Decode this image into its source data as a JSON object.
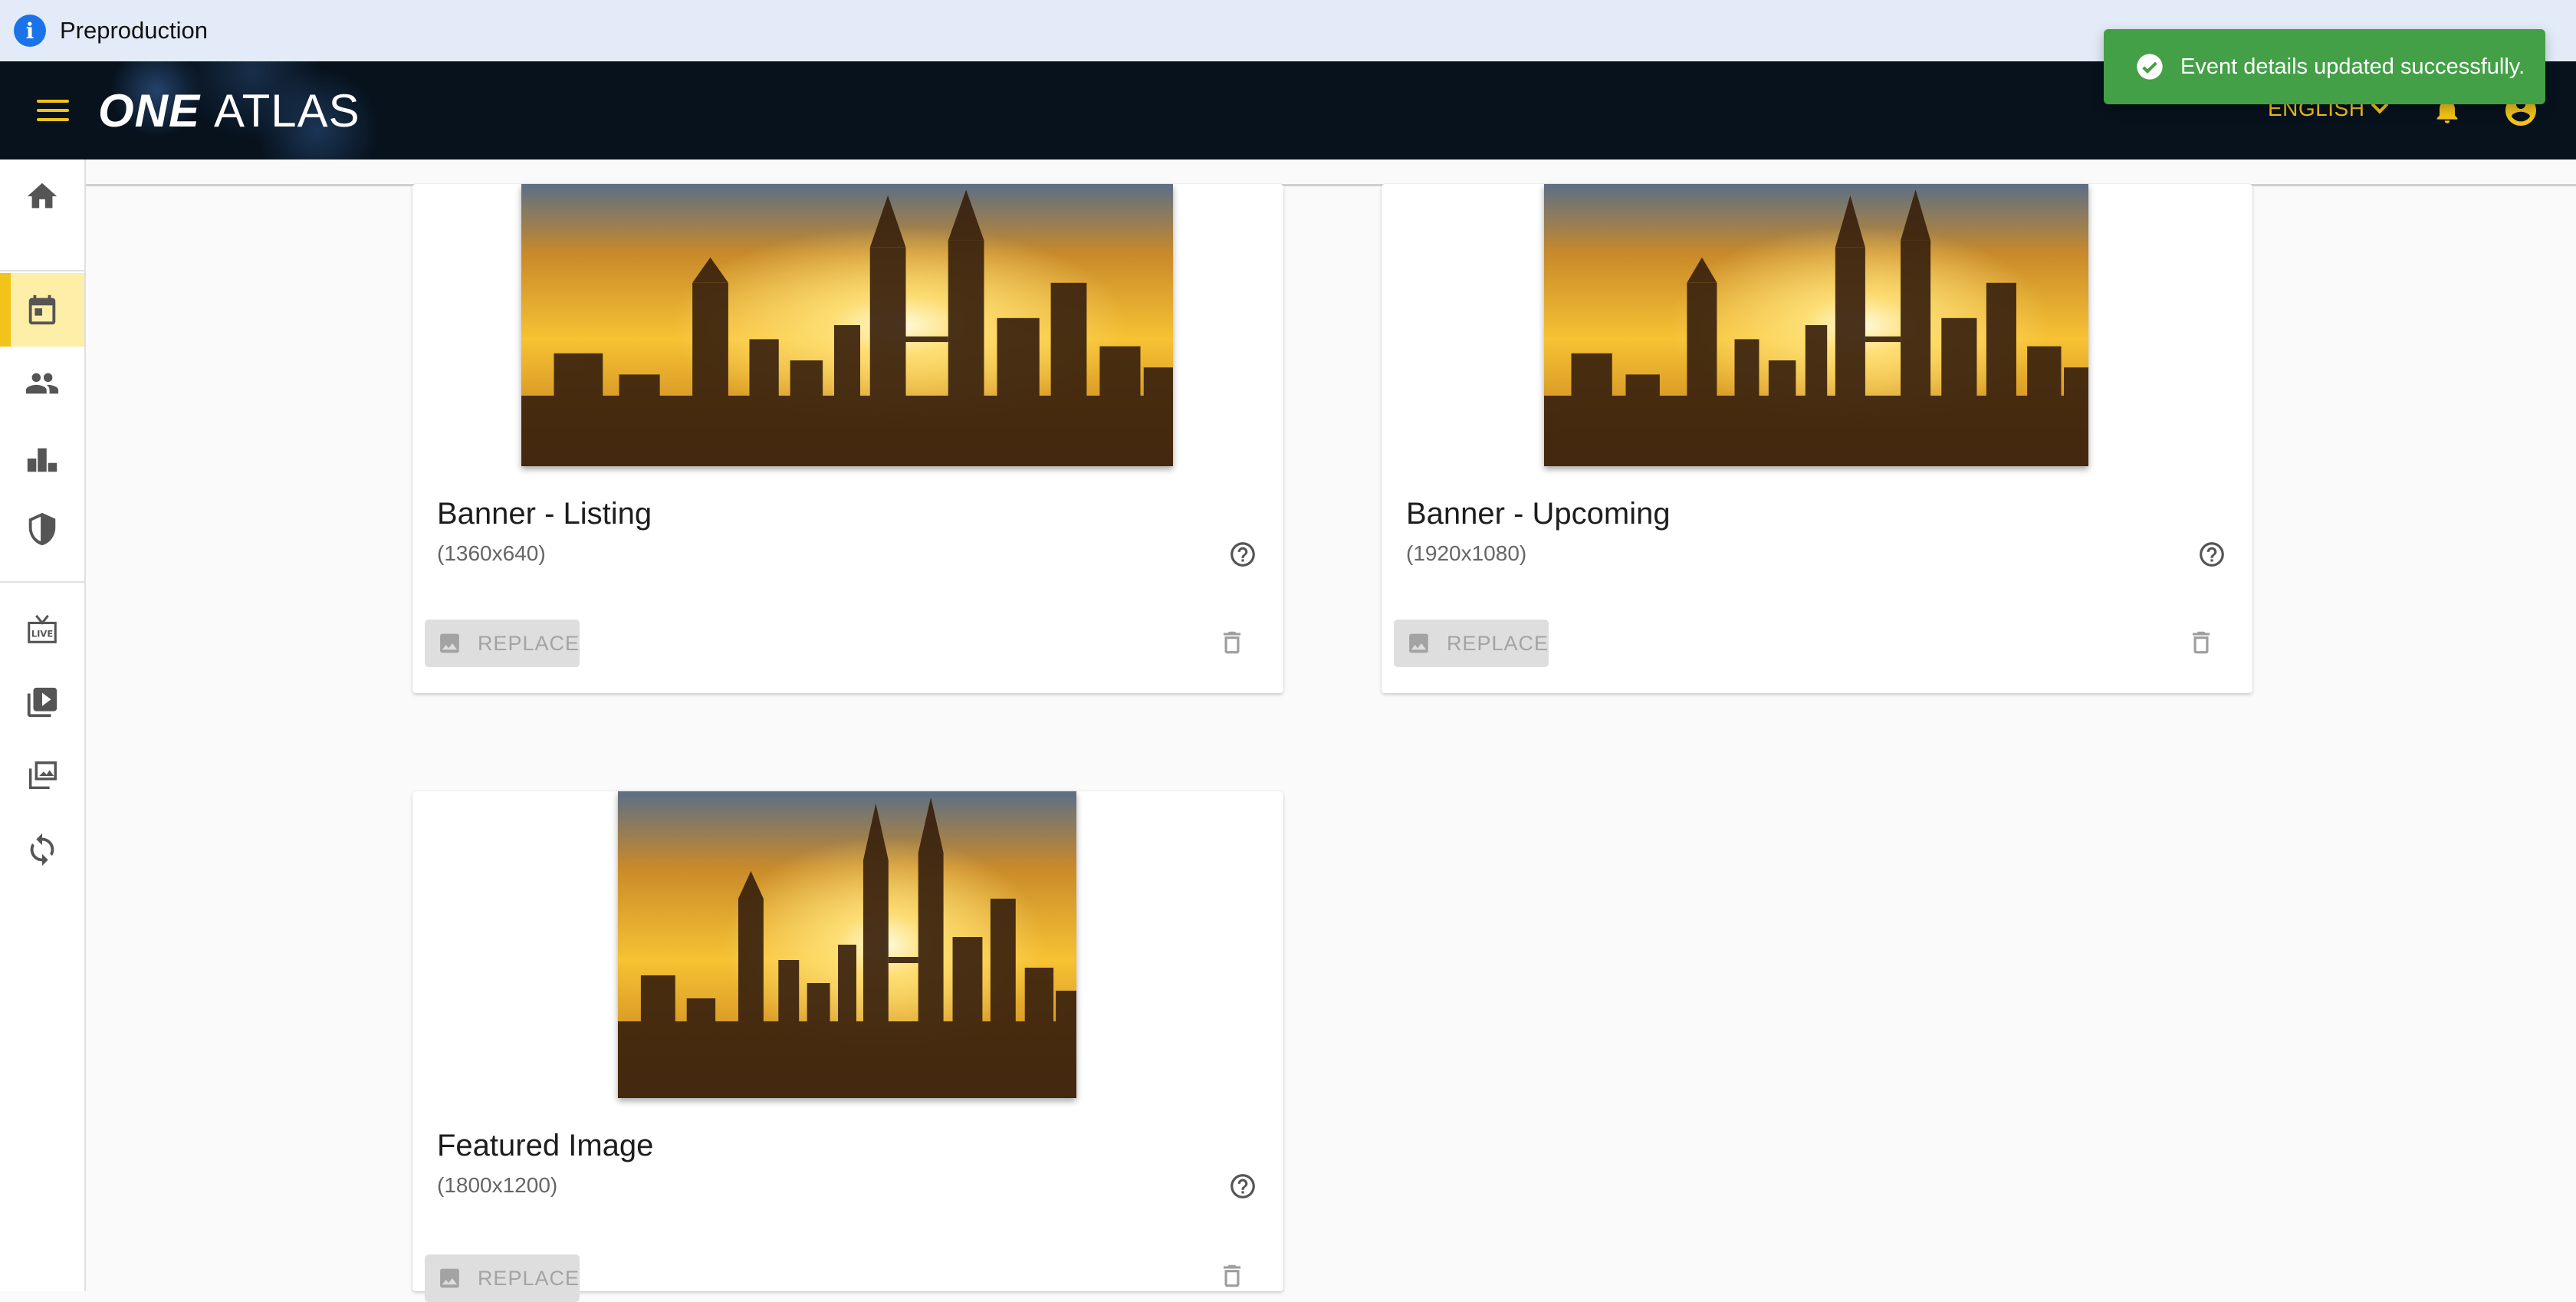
{
  "env_banner": {
    "text": "Preproduction",
    "icon": "info-icon"
  },
  "toast": {
    "message": "Event details updated successfully.",
    "icon": "check-circle-icon",
    "color": "#43a047"
  },
  "appbar": {
    "logo_one": "ONE",
    "logo_atlas": "ATLAS",
    "language": "ENGLISH",
    "accent_color": "#f2c318",
    "background_color": "#07121d"
  },
  "sidebar": {
    "items": [
      {
        "name": "home",
        "icon": "home-icon",
        "active": false
      },
      {
        "name": "events",
        "icon": "calendar-icon",
        "active": true
      },
      {
        "name": "people",
        "icon": "people-icon",
        "active": false
      },
      {
        "name": "rankings",
        "icon": "podium-icon",
        "active": false
      },
      {
        "name": "teams",
        "icon": "shield-icon",
        "active": false
      },
      {
        "name": "live",
        "icon": "live-tv-icon",
        "active": false
      },
      {
        "name": "videos",
        "icon": "video-library-icon",
        "active": false
      },
      {
        "name": "galleries",
        "icon": "photo-library-icon",
        "active": false
      },
      {
        "name": "sync",
        "icon": "sync-icon",
        "active": false
      }
    ]
  },
  "cards": [
    {
      "title": "Banner - Listing",
      "dimensions": "(1360x640)",
      "replace_label": "REPLACE"
    },
    {
      "title": "Banner - Upcoming",
      "dimensions": "(1920x1080)",
      "replace_label": "REPLACE"
    },
    {
      "title": "Featured Image",
      "dimensions": "(1800x1200)",
      "replace_label": "REPLACE"
    }
  ]
}
